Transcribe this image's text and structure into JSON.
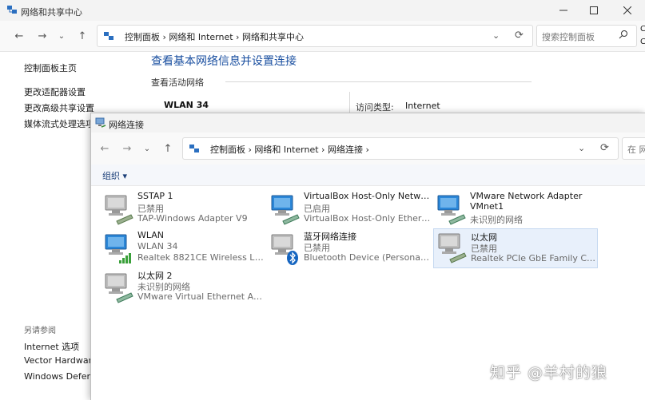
{
  "back_window": {
    "title": "网络和共享中心",
    "breadcrumb": "控制面板  ›  网络和 Internet  ›  网络和共享中心",
    "search_placeholder": "搜索控制面板",
    "sidebar": {
      "home": "控制面板主页",
      "items": [
        "更改适配器设置",
        "更改高级共享设置",
        "媒体流式处理选项"
      ],
      "see_also_title": "另请参阅",
      "see_also": [
        "Internet 选项",
        "Vector Hardware",
        "Windows Defende"
      ]
    },
    "heading": "查看基本网络信息并设置连接",
    "active_networks_label": "查看活动网络",
    "network_name": "WLAN 34",
    "access_type_label": "访问类型:",
    "access_type_value": "Internet",
    "right_edge_fragments": [
      "C",
      "C"
    ]
  },
  "front_window": {
    "title": "网络连接",
    "breadcrumb": "控制面板  ›  网络和 Internet  ›  网络连接  ›",
    "search_placeholder": "在 网",
    "organize_label": "组织 ▾",
    "adapters": [
      {
        "name": "SSTAP 1",
        "status": "已禁用",
        "device": "TAP-Windows Adapter V9",
        "icon": "ethernet-adapter-disabled-icon"
      },
      {
        "name": "VirtualBox Host-Only Network",
        "status": "已启用",
        "device": "VirtualBox Host-Only Ethernet ...",
        "icon": "ethernet-adapter-icon"
      },
      {
        "name": "VMware Network Adapter VMnet1",
        "name_line2": "VMnet1",
        "status": "未识别的网络",
        "icon": "ethernet-adapter-icon"
      },
      {
        "name": "WLAN",
        "status": "WLAN 34",
        "device": "Realtek 8821CE Wireless LAN ...",
        "icon": "wifi-adapter-icon"
      },
      {
        "name": "蓝牙网络连接",
        "status": "已禁用",
        "device": "Bluetooth Device (Personal Are...",
        "icon": "bluetooth-adapter-icon"
      },
      {
        "name": "以太网",
        "status": "已禁用",
        "device": "Realtek PCIe GbE Family Contr...",
        "icon": "ethernet-adapter-disabled-icon"
      },
      {
        "name": "以太网 2",
        "status": "未识别的网络",
        "device": "VMware Virtual Ethernet Adap...",
        "icon": "ethernet-adapter-icon"
      }
    ]
  },
  "watermark": "知乎 @羊村的狼",
  "colors": {
    "heading": "#1a4fa0",
    "selection": "#e8f0fb",
    "monitor": "#2b87d8"
  }
}
